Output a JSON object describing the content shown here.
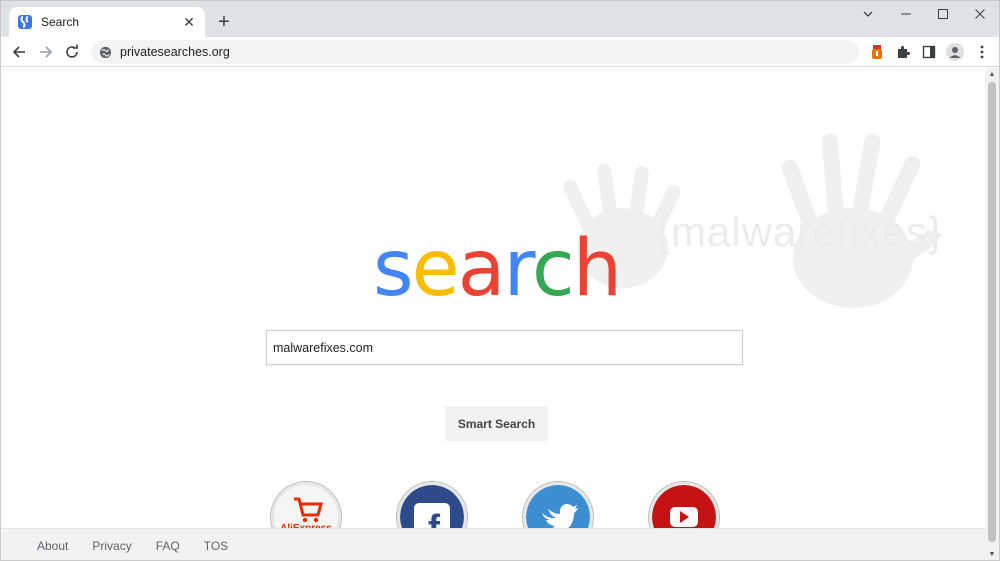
{
  "browser": {
    "tab_title": "Search",
    "new_tab_symbol": "+",
    "url": "privatesearches.org"
  },
  "page": {
    "logo_letters": [
      {
        "char": "s",
        "color": "#4285f4"
      },
      {
        "char": "e",
        "color": "#fbbc05"
      },
      {
        "char": "a",
        "color": "#ea4335"
      },
      {
        "char": "r",
        "color": "#4285f4"
      },
      {
        "char": "c",
        "color": "#34a853"
      },
      {
        "char": "h",
        "color": "#ea4335"
      }
    ],
    "search_value": "malwarefixes.com",
    "smart_search_label": "Smart Search",
    "watermark_text": "{malwarefixes}",
    "shortcuts": [
      {
        "name": "aliexpress",
        "icon": "aliexpress-icon",
        "text": "AliExpress"
      },
      {
        "name": "facebook",
        "icon": "facebook-icon",
        "text": "f"
      },
      {
        "name": "twitter",
        "icon": "twitter-icon"
      },
      {
        "name": "youtube",
        "icon": "youtube-icon"
      }
    ]
  },
  "footer": {
    "links": [
      "About",
      "Privacy",
      "FAQ",
      "TOS"
    ]
  }
}
